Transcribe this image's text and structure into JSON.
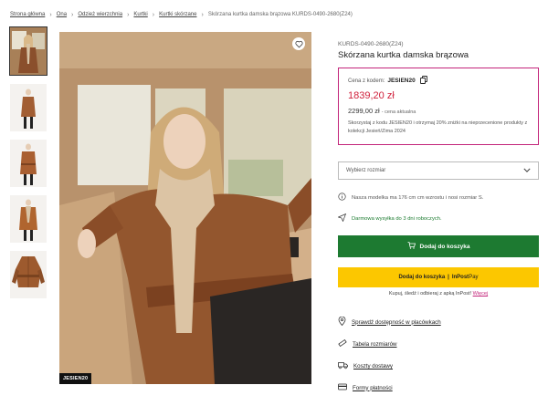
{
  "breadcrumb": {
    "items": [
      "Strona główna",
      "Ona",
      "Odzież wierzchnia",
      "Kurtki",
      "Kurtki skórzane"
    ],
    "current": "Skórzana kurtka damska brązowa KURDS-0490-2680(Z24)"
  },
  "gallery": {
    "thumbnail_count": 5,
    "active_index": 0
  },
  "main_image": {
    "promo_tag": "JESIEN20"
  },
  "product": {
    "sku": "KURDS-0490-2680(Z24)",
    "title": "Skórzana kurtka damska brązowa"
  },
  "price_box": {
    "code_label": "Cena z kodem:",
    "code": "JESIEN20",
    "promo_price": "1839,20 zł",
    "old_price": "2299,00 zł",
    "old_price_note": "- cena aktualna",
    "promo_description": "Skorzystaj z kodu JESIEN20 i otrzymaj 20% zniżki na nieprzecenione produkty z kolekcji Jesień/Zima 2024"
  },
  "size_select": {
    "placeholder": "Wybierz rozmiar"
  },
  "model_info": "Nasza modelka ma 176 cm cm wzrostu i nosi rozmiar S.",
  "shipping_info": "Darmowa wysyłka do 3 dni roboczych.",
  "cart_button": "Dodaj do koszyka",
  "inpost_button": {
    "label": "Dodaj do koszyka",
    "logo_in": "InPost",
    "logo_pay": "Pay"
  },
  "inpost_note": {
    "text": "Kupuj, śledź i odbieraj z apką InPost!",
    "more": "Więcej"
  },
  "links": [
    "Sprawdź dostępność w placówkach",
    "Tabela rozmiarów",
    "Koszty dostawy",
    "Formy płatności"
  ],
  "colors": {
    "accent": "#c3257a",
    "promo_price": "#d0213c",
    "cart_green": "#1d7a31",
    "inpost_yellow": "#fcc700",
    "jacket_brown": "#9b5a32"
  }
}
